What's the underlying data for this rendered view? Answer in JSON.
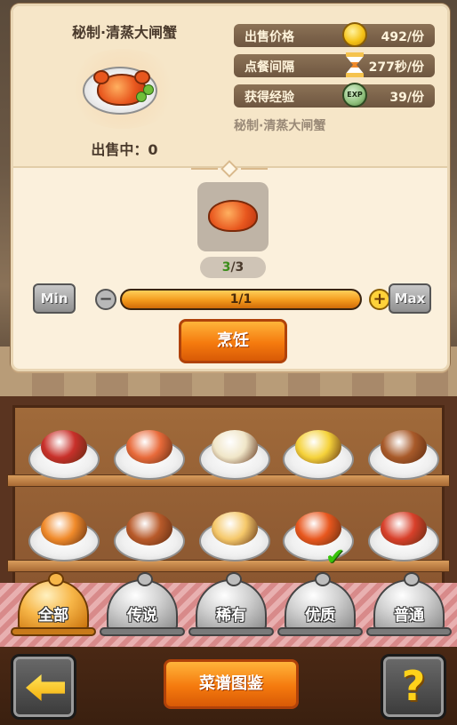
{
  "dish": {
    "title": "秘制·清蒸大闸蟹",
    "name_small": "秘制·清蒸大闸蟹",
    "sale_status": "出售中：0"
  },
  "stats": [
    {
      "label": "出售价格",
      "icon": "coin-icon",
      "value": "492/份"
    },
    {
      "label": "点餐间隔",
      "icon": "hourglass-icon",
      "value": "277秒/份"
    },
    {
      "label": "获得经验",
      "icon": "exp-icon",
      "value": "39/份"
    }
  ],
  "exp_icon_text": "EXP",
  "ingredient": {
    "icon": "crab-icon",
    "have": "3",
    "need": "/3"
  },
  "quantity": {
    "min_label": "Min",
    "max_label": "Max",
    "minus_label": "−",
    "plus_label": "+",
    "progress_text": "1/1",
    "fill_fraction": 1.0
  },
  "cook_button": "烹饪",
  "shelf_dishes": [
    {
      "name": "red-meat-bowl-icon",
      "food_color": "#c8302a"
    },
    {
      "name": "shrimp-tofu-bowl-icon",
      "food_color": "#e86a3a"
    },
    {
      "name": "fried-rice-bowl-icon",
      "food_color": "#f0e6c8"
    },
    {
      "name": "scrambled-egg-plate-icon",
      "food_color": "#f5d23a"
    },
    {
      "name": "roast-duck-plate-icon",
      "food_color": "#a85a2a"
    },
    {
      "name": "fried-lobster-plate-icon",
      "food_color": "#f08a2a"
    },
    {
      "name": "skewers-plate-icon",
      "food_color": "#b85a2a"
    },
    {
      "name": "soup-pot-icon",
      "food_color": "#f5c86a"
    },
    {
      "name": "steamed-crab-plate-icon",
      "food_color": "#e8571e"
    },
    {
      "name": "spicy-stew-pot-icon",
      "food_color": "#d8402a"
    }
  ],
  "tabs": [
    {
      "label": "全部",
      "active": true
    },
    {
      "label": "传说",
      "active": false
    },
    {
      "label": "稀有",
      "active": false
    },
    {
      "label": "优质",
      "active": false
    },
    {
      "label": "普通",
      "active": false
    }
  ],
  "bottom": {
    "recipe_button": "菜谱图鉴",
    "help_label": "?"
  },
  "colors": {
    "accent_orange": "#f57a0e",
    "panel_bg": "#fbf0dc",
    "stat_bg": "#8c7256",
    "active_tab": "#f7b648"
  }
}
